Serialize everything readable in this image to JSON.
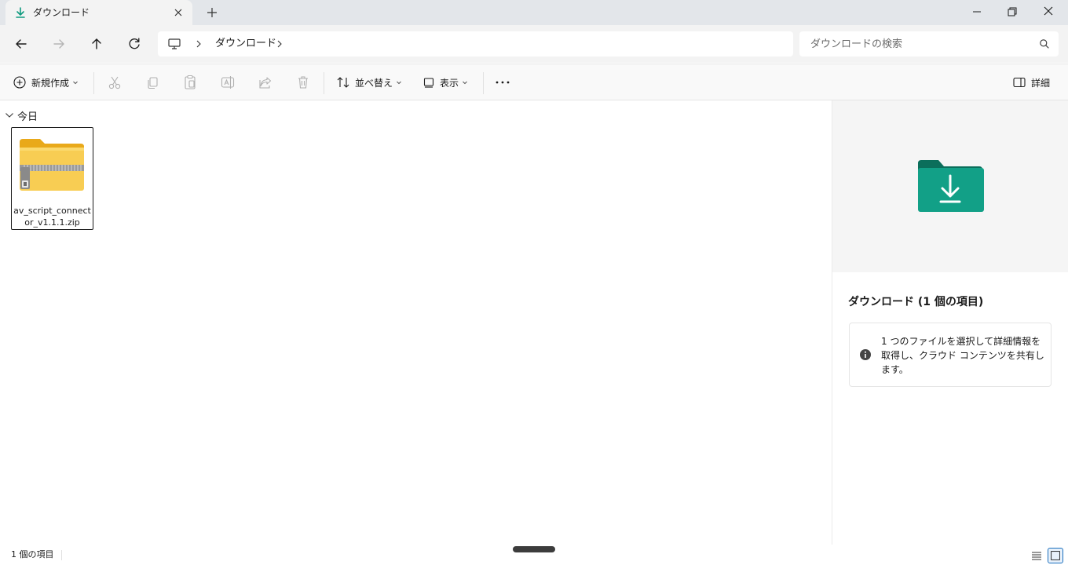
{
  "tab": {
    "title": "ダウンロード"
  },
  "address": {
    "crumb": "ダウンロード"
  },
  "search": {
    "placeholder": "ダウンロードの検索"
  },
  "commands": {
    "new_label": "新規作成",
    "sort_label": "並べ替え",
    "view_label": "表示",
    "details_label": "詳細"
  },
  "content": {
    "group_label": "今日",
    "items": [
      {
        "name": "av_script_connector_v1.1.1.zip"
      }
    ]
  },
  "details": {
    "title": "ダウンロード (1 個の項目)",
    "info_text": "1 つのファイルを選択して詳細情報を取得し、クラウド コンテンツを共有します。"
  },
  "status": {
    "count": "1 個の項目"
  },
  "colors": {
    "accent": "#1a6fbd",
    "download_green": "#0f9a7f",
    "folder_yellow": "#f5c444"
  }
}
